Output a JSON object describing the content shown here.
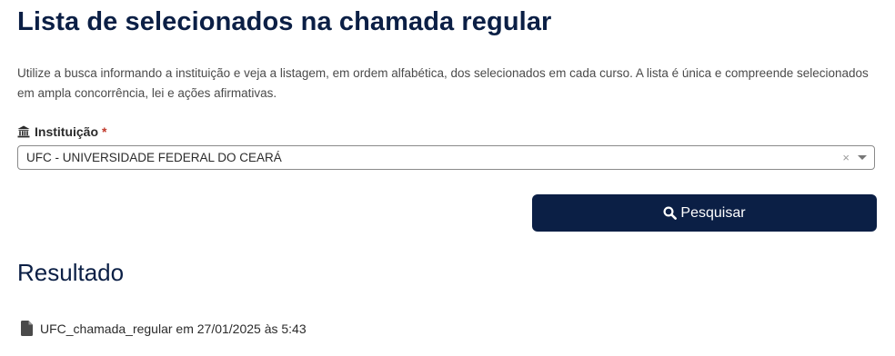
{
  "page": {
    "title": "Lista de selecionados na chamada regular",
    "intro": "Utilize a busca informando a instituição e veja a listagem, em ordem alfabética, dos selecionados em cada curso. A lista é única e compreende selecionados em ampla concorrência, lei e ações afirmativas."
  },
  "form": {
    "institution_label": "Instituição",
    "required_mark": "*",
    "institution_value": "UFC - UNIVERSIDADE FEDERAL DO CEARÁ",
    "clear_symbol": "×",
    "search_label": "Pesquisar",
    "icons": {
      "label_icon": "bank-icon",
      "search_icon": "search-icon",
      "clear_icon": "close-icon",
      "dropdown_icon": "caret-down-icon"
    }
  },
  "result": {
    "heading": "Resultado",
    "file_label": "UFC_chamada_regular em 27/01/2025 às 5:43",
    "file_icon": "document-icon"
  },
  "colors": {
    "primary": "#0b1f45",
    "required": "#c0392b",
    "text": "#4a4a4a"
  }
}
